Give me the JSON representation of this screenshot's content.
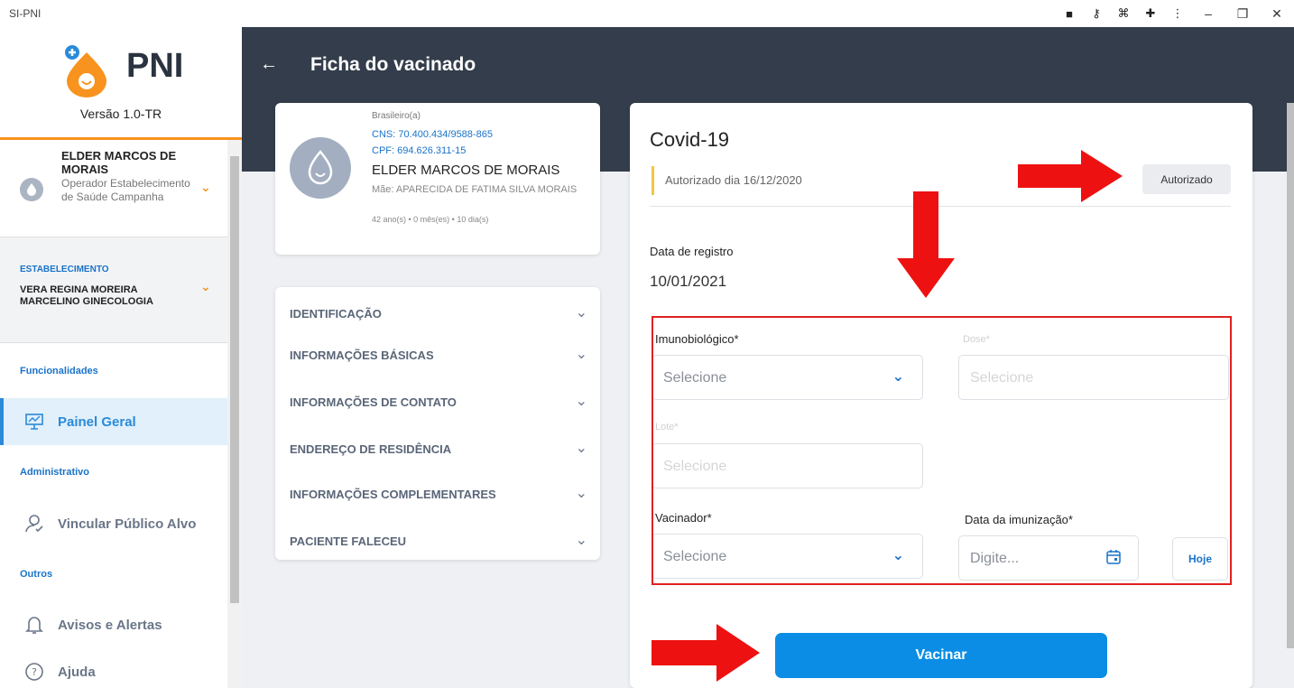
{
  "window": {
    "title": "SI-PNI"
  },
  "sidebar": {
    "logo_text": "PNI",
    "version": "Versão 1.0-TR",
    "user": {
      "name": "ELDER MARCOS DE MORAIS",
      "role": "Operador Estabelecimento de Saúde Campanha"
    },
    "estabelecimento": {
      "label": "ESTABELECIMENTO",
      "name": "VERA REGINA MOREIRA MARCELINO GINECOLOGIA"
    },
    "sections": {
      "funcionalidades": "Funcionalidades",
      "administrativo": "Administrativo",
      "outros": "Outros"
    },
    "items": {
      "painel": "Painel Geral",
      "vincular": "Vincular Público Alvo",
      "avisos": "Avisos e Alertas",
      "ajuda": "Ajuda"
    }
  },
  "header": {
    "title": "Ficha do vacinado"
  },
  "patient": {
    "nationality": "Brasileiro(a)",
    "cns": "CNS: 70.400.434/9588-865",
    "cpf": "CPF: 694.626.311-15",
    "name": "ELDER MARCOS DE MORAIS",
    "mother": "Mãe: APARECIDA DE FATIMA SILVA MORAIS",
    "age": "42 ano(s) • 0 mês(es) • 10 dia(s)"
  },
  "accordion": [
    "IDENTIFICAÇÃO",
    "INFORMAÇÕES BÁSICAS",
    "INFORMAÇÕES DE CONTATO",
    "ENDEREÇO DE RESIDÊNCIA",
    "INFORMAÇÕES COMPLEMENTARES",
    "PACIENTE FALECEU"
  ],
  "vaccine": {
    "title": "Covid-19",
    "auth_text": "Autorizado dia 16/12/2020",
    "auth_button": "Autorizado",
    "reg_label": "Data de registro",
    "reg_value": "10/01/2021",
    "imuno_label": "Imunobiológico*",
    "imuno_placeholder": "Selecione",
    "dose_label": "Dose*",
    "dose_placeholder": "Selecione",
    "lote_label": "Lote*",
    "lote_placeholder": "Selecione",
    "vacinador_label": "Vacinador*",
    "vacinador_placeholder": "Selecione",
    "data_label": "Data da imunização*",
    "data_placeholder": "Digite...",
    "hoje": "Hoje",
    "vacinar": "Vacinar"
  },
  "colors": {
    "header": "#343d4b",
    "accent": "#0b8de6",
    "orange": "#f7931e",
    "annotation": "#e02020"
  }
}
